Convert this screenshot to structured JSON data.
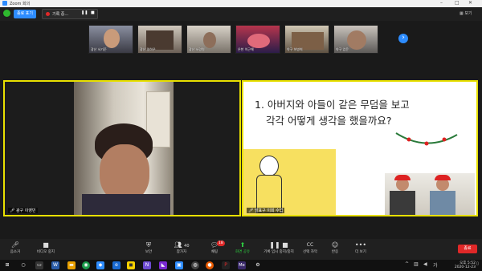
{
  "window": {
    "title": "Zoom 회의",
    "controls": [
      "–",
      "□",
      "✕"
    ]
  },
  "topbar": {
    "status_label": "종료 표기",
    "recording_label": "기록 중...",
    "pause_glyph": "❚❚",
    "stop_glyph": "■",
    "view_label": "보기",
    "accent": "#2d8cff"
  },
  "gallery": {
    "participants": [
      {
        "name": "광산 서기준"
      },
      {
        "name": "광산 일하우"
      },
      {
        "name": "광산 서경원"
      },
      {
        "name": "은천 이근해"
      },
      {
        "name": "약구 허병희"
      },
      {
        "name": "약구 엄윤"
      }
    ],
    "next_glyph": "›"
  },
  "main": {
    "left_name": "광구 이영민",
    "right_name": "발표구 이희 수업",
    "slide_question_line1": "1. 아버지와 아들이 같은 무덤을 보고",
    "slide_question_line2": "각각 어떻게 생각을 했을까요?",
    "active_border": "#e8e000"
  },
  "toolbar": {
    "mute_label": "음소거",
    "video_label": "비디오 중지",
    "security_label": "보안",
    "participants_label": "참가자",
    "participants_count": "40",
    "chat_label": "채팅",
    "chat_badge": "18",
    "share_label": "화면 공유",
    "record_label": "기록 임시 중지/중지",
    "cc_label": "선택 자막",
    "reactions_label": "반응",
    "more_label": "더 보기",
    "end_label": "종료",
    "end_color": "#e02828"
  },
  "taskbar": {
    "time": "오후 5:52",
    "date": "2020-12-23",
    "lang": "가"
  }
}
